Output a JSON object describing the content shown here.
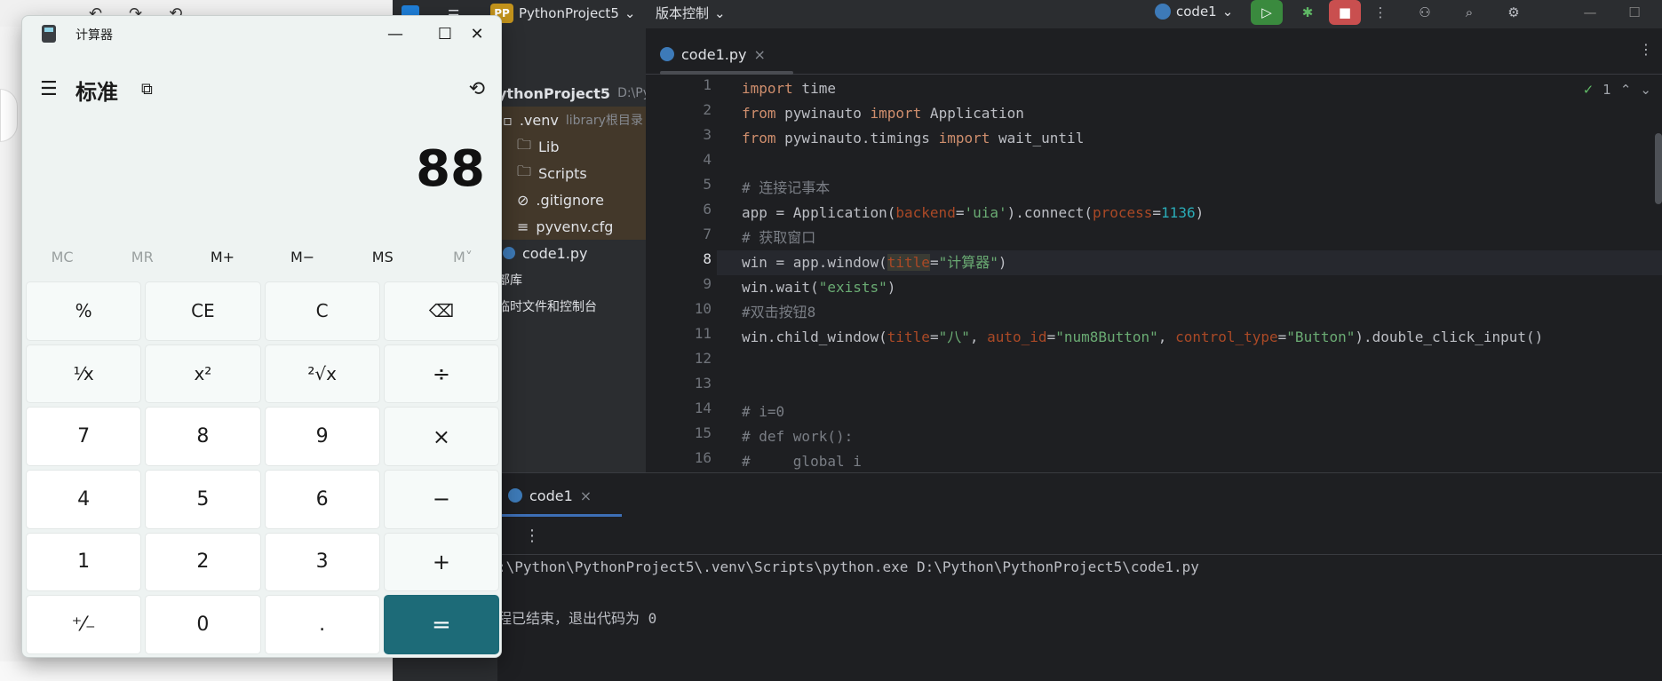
{
  "ide": {
    "project_badge": "PP",
    "project_name": "PythonProject5",
    "vcs_menu": "版本控制",
    "run_config": "code1",
    "tree": {
      "root_label": "ythonProject5",
      "root_path": "D:\\Pyt",
      "venv_label": ".venv",
      "venv_note": "library根目录",
      "items": [
        "Lib",
        "Scripts",
        ".gitignore",
        "pyvenv.cfg"
      ],
      "file": "code1.py",
      "ext_libs": "部库",
      "scratches": "临时文件和控制台"
    },
    "editor": {
      "tab_label": "code1.py",
      "inspection_count": "1",
      "current_line": 8,
      "line_numbers": [
        "1",
        "2",
        "3",
        "4",
        "5",
        "6",
        "7",
        "8",
        "9",
        "10",
        "11",
        "12",
        "13",
        "14",
        "15",
        "16"
      ]
    },
    "run": {
      "tab_label": "code1",
      "command": ":\\Python\\PythonProject5\\.venv\\Scripts\\python.exe D:\\Python\\PythonProject5\\code1.py",
      "exit_message": "程已结束，退出代码为 0"
    }
  },
  "calculator": {
    "window_title": "计算器",
    "mode_title": "标准",
    "display_value": "88",
    "memory_buttons": [
      {
        "label": "MC",
        "enabled": false
      },
      {
        "label": "MR",
        "enabled": false
      },
      {
        "label": "M+",
        "enabled": true
      },
      {
        "label": "M−",
        "enabled": true
      },
      {
        "label": "MS",
        "enabled": true
      },
      {
        "label": "M˅",
        "enabled": false
      }
    ],
    "keys": {
      "percent": "%",
      "ce": "CE",
      "c": "C",
      "backspace": "⌫",
      "reciprocal": "⅟x",
      "square": "x²",
      "sqrt": "²√x",
      "divide": "÷",
      "seven": "7",
      "eight": "8",
      "nine": "9",
      "multiply": "×",
      "four": "4",
      "five": "5",
      "six": "6",
      "minus": "−",
      "one": "1",
      "two": "2",
      "three": "3",
      "plus": "+",
      "negate": "⁺⁄₋",
      "zero": "0",
      "decimal": ".",
      "equals": "="
    },
    "accent_color": "#1d6b78"
  }
}
